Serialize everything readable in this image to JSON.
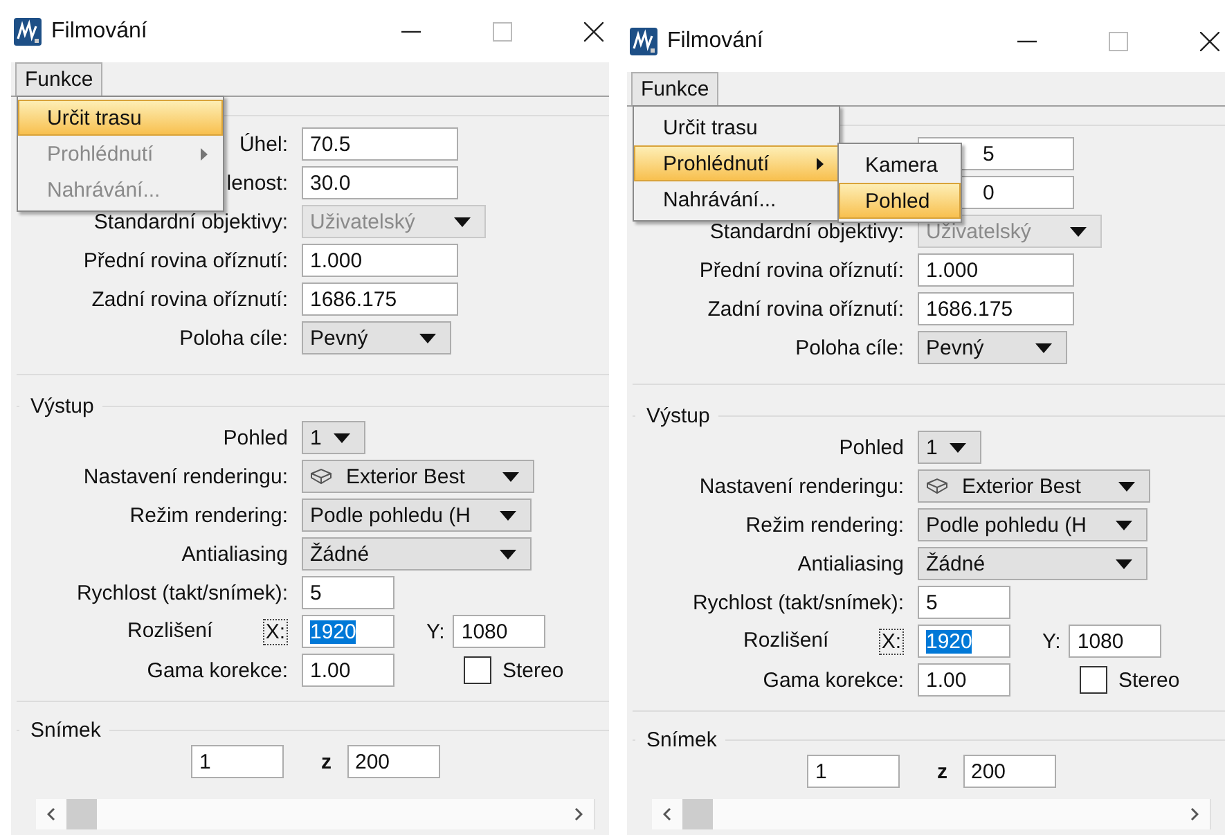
{
  "windows": [
    {
      "title": "Filmování",
      "menu_bar": [
        {
          "label": "Funkce",
          "selected": true
        }
      ],
      "menu": [
        {
          "label": "Určit trasu",
          "selected": true,
          "disabled": false,
          "has_submenu": false
        },
        {
          "label": "Prohlédnutí",
          "selected": false,
          "disabled": true,
          "has_submenu": true
        },
        {
          "label": "Nahrávání...",
          "selected": false,
          "disabled": true,
          "has_submenu": false
        }
      ],
      "camera_fields": [
        {
          "kind": "text",
          "label": "Úhel:",
          "value": "70.5"
        },
        {
          "kind": "text",
          "label": "lenost:",
          "value": "30.0"
        },
        {
          "kind": "dropdown",
          "label": "Standardní objektivy:",
          "value": "Uživatelský",
          "disabled": true
        },
        {
          "kind": "text",
          "label": "Přední rovina oříznutí:",
          "value": "1.000"
        },
        {
          "kind": "text",
          "label": "Zadní rovina oříznutí:",
          "value": "1686.175"
        },
        {
          "kind": "dropdown",
          "label": "Poloha cíle:",
          "value": "Pevný",
          "disabled": false
        }
      ],
      "output": {
        "title": "Výstup",
        "rows": [
          {
            "kind": "dropdown",
            "label": "Pohled",
            "value": "1",
            "disabled": false
          },
          {
            "kind": "dropdown",
            "label": "Nastavení renderingu:",
            "value": "Exterior Best",
            "disabled": false,
            "has_icon": true
          },
          {
            "kind": "dropdown",
            "label": "Režim rendering:",
            "value": "Podle pohledu (H",
            "disabled": false
          },
          {
            "kind": "dropdown",
            "label": "Antialiasing",
            "value": "Žádné",
            "disabled": false
          },
          {
            "kind": "text",
            "label": "Rychlost (takt/snímek):",
            "value": "5"
          },
          {
            "kind": "resolution",
            "label": "Rozlišení",
            "x_label": "X:",
            "x_value": "1920",
            "x_selected": true,
            "y_label": "Y:",
            "y_value": "1080"
          },
          {
            "kind": "gamma",
            "label": "Gama korekce:",
            "value": "1.00",
            "checkbox_label": "Stereo",
            "checked": false
          }
        ]
      },
      "frame": {
        "title": "Snímek",
        "from": "1",
        "separator": "z",
        "to": "200"
      }
    },
    {
      "title": "Filmování",
      "menu_bar": [
        {
          "label": "Funkce",
          "selected": true
        }
      ],
      "menu": [
        {
          "label": "Určit trasu",
          "selected": false,
          "disabled": false,
          "has_submenu": false
        },
        {
          "label": "Prohlédnutí",
          "selected": true,
          "disabled": false,
          "has_submenu": true,
          "submenu": [
            {
              "label": "Kamera",
              "selected": false
            },
            {
              "label": "Pohled",
              "selected": true
            }
          ]
        },
        {
          "label": "Nahrávání...",
          "selected": false,
          "disabled": false,
          "has_submenu": false
        }
      ],
      "camera_fields": [
        {
          "kind": "text",
          "value": "5"
        },
        {
          "kind": "text",
          "value": "0"
        },
        {
          "kind": "dropdown",
          "label": "Standardní objektivy:",
          "value": "Uživatelský",
          "disabled": true
        },
        {
          "kind": "text",
          "label": "Přední rovina oříznutí:",
          "value": "1.000"
        },
        {
          "kind": "text",
          "label": "Zadní rovina oříznutí:",
          "value": "1686.175"
        },
        {
          "kind": "dropdown",
          "label": "Poloha cíle:",
          "value": "Pevný",
          "disabled": false
        }
      ],
      "output": {
        "title": "Výstup",
        "rows": [
          {
            "kind": "dropdown",
            "label": "Pohled",
            "value": "1",
            "disabled": false
          },
          {
            "kind": "dropdown",
            "label": "Nastavení renderingu:",
            "value": "Exterior Best",
            "disabled": false,
            "has_icon": true
          },
          {
            "kind": "dropdown",
            "label": "Režim rendering:",
            "value": "Podle pohledu (H",
            "disabled": false
          },
          {
            "kind": "dropdown",
            "label": "Antialiasing",
            "value": "Žádné",
            "disabled": false
          },
          {
            "kind": "text",
            "label": "Rychlost (takt/snímek):",
            "value": "5"
          },
          {
            "kind": "resolution",
            "label": "Rozlišení",
            "x_label": "X:",
            "x_value": "1920",
            "x_selected": true,
            "y_label": "Y:",
            "y_value": "1080"
          },
          {
            "kind": "gamma",
            "label": "Gama korekce:",
            "value": "1.00",
            "checkbox_label": "Stereo",
            "checked": false
          }
        ]
      },
      "frame": {
        "title": "Snímek",
        "from": "1",
        "separator": "z",
        "to": "200"
      }
    }
  ]
}
